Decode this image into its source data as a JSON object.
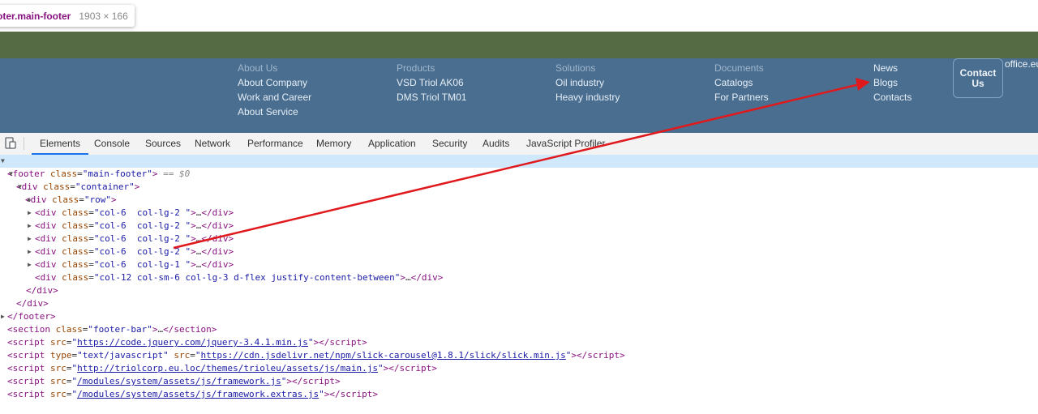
{
  "tooltip": {
    "selector": "oter.main-footer",
    "dims": "1903 × 166"
  },
  "footer": {
    "columns": [
      {
        "header": "About Us",
        "items": [
          "About Company",
          "Work and Career",
          "About Service"
        ]
      },
      {
        "header": "Products",
        "items": [
          "VSD Triol AK06",
          "DMS Triol TM01"
        ]
      },
      {
        "header": "Solutions",
        "items": [
          "Oil industry",
          "Heavy industry"
        ]
      },
      {
        "header": "Documents",
        "items": [
          "Catalogs",
          "For Partners"
        ]
      },
      {
        "header": "News",
        "items": [
          "Blogs",
          "Contacts"
        ]
      }
    ],
    "contact_button": "Contact Us",
    "office_text": "office.eu"
  },
  "devtools": {
    "tabs": [
      "Elements",
      "Console",
      "Sources",
      "Network",
      "Performance",
      "Memory",
      "Application",
      "Security",
      "Audits",
      "JavaScript Profiler"
    ],
    "active_tab": "Elements",
    "dom": {
      "footer_open": {
        "tag": "footer",
        "attr": "class",
        "val": "main-footer",
        "marker": "== $0"
      },
      "container": {
        "tag": "div",
        "attr": "class",
        "val": "container"
      },
      "row": {
        "tag": "div",
        "attr": "class",
        "val": "row"
      },
      "cols": [
        "col-6  col-lg-2 ",
        "col-6  col-lg-2 ",
        "col-6  col-lg-2 ",
        "col-6  col-lg-2 ",
        "col-6  col-lg-1 ",
        "col-12 col-sm-6 col-lg-3 d-flex justify-content-between"
      ],
      "close_div": "</div>",
      "close_footer": "</footer>",
      "section": {
        "tag": "section",
        "attr": "class",
        "val": "footer-bar"
      },
      "scripts": [
        {
          "type": "",
          "src": "https://code.jquery.com/jquery-3.4.1.min.js"
        },
        {
          "type": "text/javascript",
          "src": "https://cdn.jsdelivr.net/npm/slick-carousel@1.8.1/slick/slick.min.js"
        },
        {
          "type": "",
          "src": "http://triolcorp.eu.loc/themes/trioleu/assets/js/main.js"
        },
        {
          "type": "",
          "src": "/modules/system/assets/js/framework.js"
        },
        {
          "type": "",
          "src": "/modules/system/assets/js/framework.extras.js"
        }
      ]
    }
  },
  "colors": {
    "annotation_arrow": "#e0191d",
    "footer_bar": "#546b44",
    "footer_highlight": "#4a6e90"
  }
}
